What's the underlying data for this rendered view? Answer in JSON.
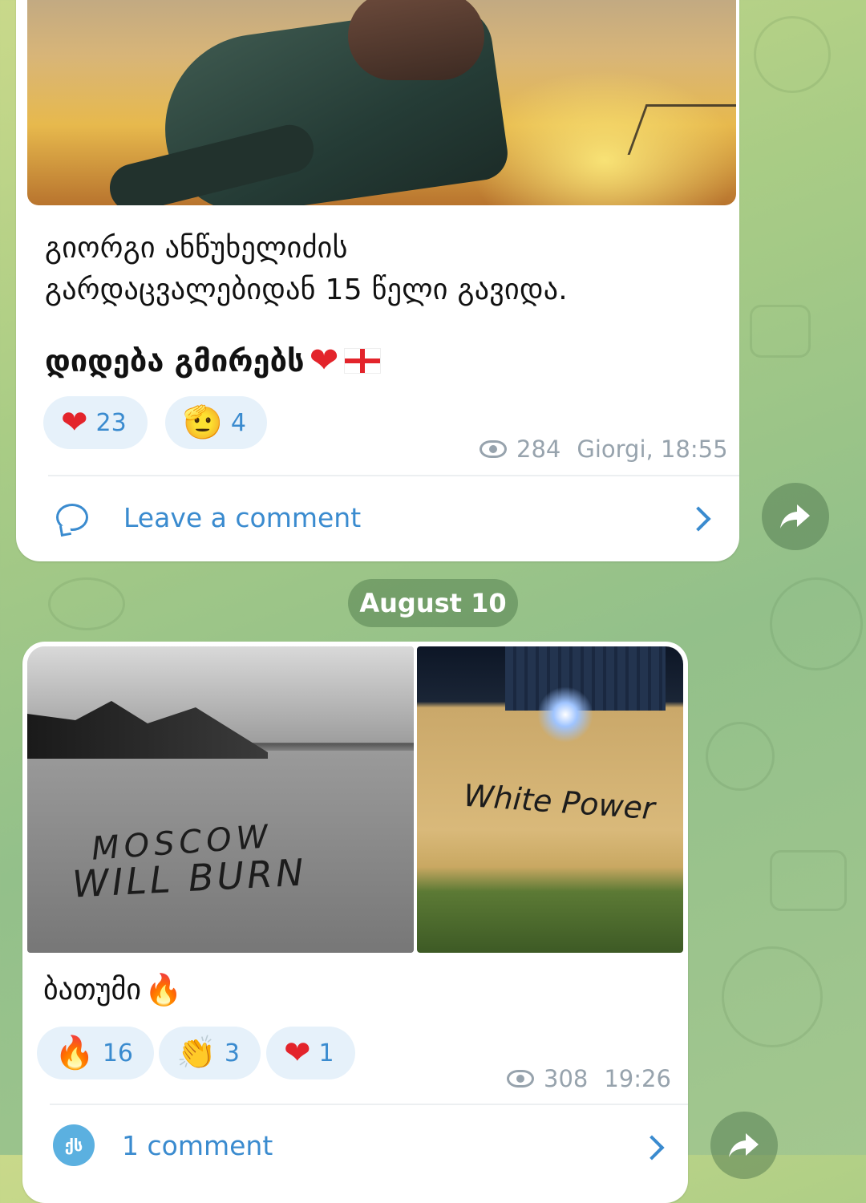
{
  "post1": {
    "caption_line1": "გიორგი ანწუხელიძის",
    "caption_line2": "გარდაცვალებიდან 15 წელი გავიდა.",
    "caption_bold": "დიდება გმირებს",
    "reactions": [
      {
        "emoji": "❤",
        "count": "23"
      },
      {
        "emoji": "🫡",
        "count": "4"
      }
    ],
    "views": "284",
    "author_time": "Giorgi, 18:55",
    "comment_label": "Leave a comment"
  },
  "date_separator": "August 10",
  "post2": {
    "photo_a_text_line1": "MOSCOW",
    "photo_a_text_line2": "WILL BURN",
    "photo_b_text": "White Power",
    "caption": "ბათუმი",
    "reactions": [
      {
        "emoji": "🔥",
        "count": "16"
      },
      {
        "emoji": "👏",
        "count": "3"
      },
      {
        "emoji": "❤",
        "count": "1"
      }
    ],
    "views": "308",
    "time": "19:26",
    "commenter_initials": "ქს",
    "comment_label": "1 comment"
  },
  "colors": {
    "accent": "#3a8bcf",
    "meta_gray": "#97a3ad",
    "reaction_bg": "#e6f1fa",
    "heart": "#e3242b"
  }
}
